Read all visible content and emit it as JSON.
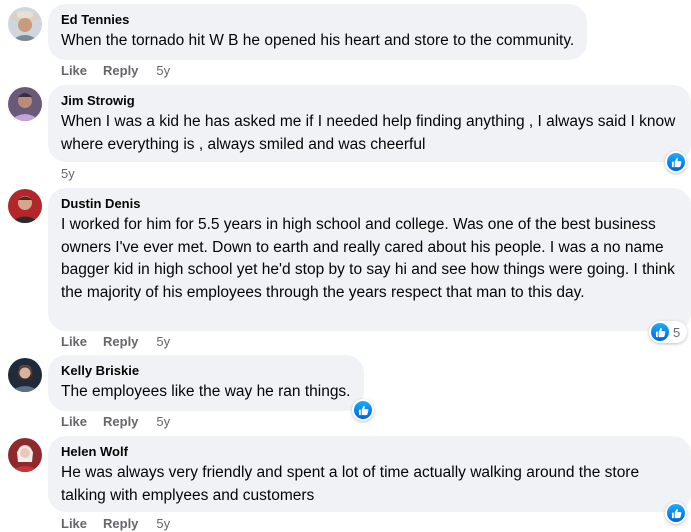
{
  "actions": {
    "like_label": "Like",
    "reply_label": "Reply"
  },
  "colors": {
    "bubble": "#f0f2f5",
    "meta_text": "#65676b",
    "reaction_blue": "#0866ff"
  },
  "comments": [
    {
      "author": "Ed Tennies",
      "text": "When the tornado hit W B he opened his heart and store to the community.",
      "time": "5y",
      "reaction_icon": "thumbs-up-icon"
    },
    {
      "author": "Jim Strowig",
      "text": "When I was a kid he has asked me if I needed help finding anything , I always said I know where everything is , always smiled and was cheerful",
      "time": "5y",
      "reaction_icon": "thumbs-up-icon"
    },
    {
      "author": "Dustin Denis",
      "text": "I worked for him for 5.5 years in high school and college. Was one of the best business owners I've ever met. Down to earth and really cared about his people. I was a no name bagger kid in high school yet he'd stop by to say hi and see how things were going. I think the majority of his employees through the years respect that man to this day.",
      "time": "5y",
      "reaction_count": "5",
      "reaction_icon": "thumbs-up-icon"
    },
    {
      "author": "Kelly Briskie",
      "text": "The employees like the way he ran things.",
      "time": "5y",
      "reaction_icon": "thumbs-up-icon"
    },
    {
      "author": "Helen Wolf",
      "text": "He was always very friendly and spent a lot of time actually walking around the store talking with emplyees and customers",
      "time": "5y",
      "reaction_icon": "thumbs-up-icon"
    }
  ]
}
